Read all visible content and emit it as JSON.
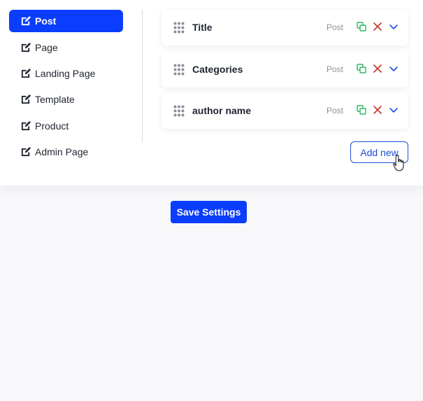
{
  "sidebar": {
    "items": [
      {
        "label": "Post",
        "icon": "edit-icon",
        "active": true
      },
      {
        "label": "Page",
        "icon": "edit-icon",
        "active": false
      },
      {
        "label": "Landing Page",
        "icon": "edit-icon",
        "active": false
      },
      {
        "label": "Template",
        "icon": "edit-icon",
        "active": false
      },
      {
        "label": "Product",
        "icon": "edit-icon",
        "active": false
      },
      {
        "label": "Admin Page",
        "icon": "edit-icon",
        "active": false
      }
    ]
  },
  "fields": [
    {
      "title": "Title",
      "type": "Post"
    },
    {
      "title": "Categories",
      "type": "Post"
    },
    {
      "title": "author name",
      "type": "Post"
    }
  ],
  "actions": {
    "add_new_label": "Add new",
    "save_label": "Save Settings"
  },
  "colors": {
    "accent": "#0b3dff",
    "copy_icon": "#2fb56a",
    "delete_icon": "#c0392b",
    "expand_icon": "#1b4fd8"
  }
}
